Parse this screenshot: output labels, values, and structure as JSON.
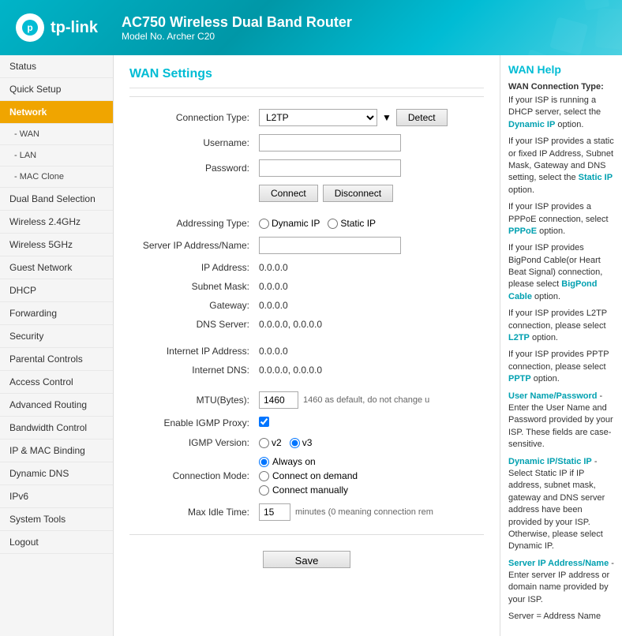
{
  "header": {
    "logo_letter": "p",
    "logo_brand": "tp-link",
    "title": "AC750 Wireless Dual Band Router",
    "model": "Model No. Archer C20"
  },
  "sidebar": {
    "items": [
      {
        "label": "Status",
        "id": "status",
        "active": false,
        "sub": false
      },
      {
        "label": "Quick Setup",
        "id": "quick-setup",
        "active": false,
        "sub": false
      },
      {
        "label": "Network",
        "id": "network",
        "active": true,
        "sub": false
      },
      {
        "label": "- WAN",
        "id": "wan",
        "active": false,
        "sub": true
      },
      {
        "label": "- LAN",
        "id": "lan",
        "active": false,
        "sub": true
      },
      {
        "label": "- MAC Clone",
        "id": "mac-clone",
        "active": false,
        "sub": true
      },
      {
        "label": "Dual Band Selection",
        "id": "dual-band",
        "active": false,
        "sub": false
      },
      {
        "label": "Wireless 2.4GHz",
        "id": "wireless-24",
        "active": false,
        "sub": false
      },
      {
        "label": "Wireless 5GHz",
        "id": "wireless-5",
        "active": false,
        "sub": false
      },
      {
        "label": "Guest Network",
        "id": "guest-network",
        "active": false,
        "sub": false
      },
      {
        "label": "DHCP",
        "id": "dhcp",
        "active": false,
        "sub": false
      },
      {
        "label": "Forwarding",
        "id": "forwarding",
        "active": false,
        "sub": false
      },
      {
        "label": "Security",
        "id": "security",
        "active": false,
        "sub": false
      },
      {
        "label": "Parental Controls",
        "id": "parental",
        "active": false,
        "sub": false
      },
      {
        "label": "Access Control",
        "id": "access-control",
        "active": false,
        "sub": false
      },
      {
        "label": "Advanced Routing",
        "id": "advanced-routing",
        "active": false,
        "sub": false
      },
      {
        "label": "Bandwidth Control",
        "id": "bandwidth",
        "active": false,
        "sub": false
      },
      {
        "label": "IP & MAC Binding",
        "id": "ip-mac",
        "active": false,
        "sub": false
      },
      {
        "label": "Dynamic DNS",
        "id": "dynamic-dns",
        "active": false,
        "sub": false
      },
      {
        "label": "IPv6",
        "id": "ipv6",
        "active": false,
        "sub": false
      },
      {
        "label": "System Tools",
        "id": "system-tools",
        "active": false,
        "sub": false
      },
      {
        "label": "Logout",
        "id": "logout",
        "active": false,
        "sub": false
      }
    ]
  },
  "content": {
    "section_title": "WAN Settings",
    "form": {
      "connection_type_label": "Connection Type:",
      "connection_type_value": "L2TP",
      "detect_btn": "Detect",
      "username_label": "Username:",
      "password_label": "Password:",
      "connect_btn": "Connect",
      "disconnect_btn": "Disconnect",
      "addressing_type_label": "Addressing Type:",
      "addressing_dynamic": "Dynamic IP",
      "addressing_static": "Static IP",
      "server_ip_label": "Server IP Address/Name:",
      "ip_address_label": "IP Address:",
      "ip_address_value": "0.0.0.0",
      "subnet_mask_label": "Subnet Mask:",
      "subnet_mask_value": "0.0.0.0",
      "gateway_label": "Gateway:",
      "gateway_value": "0.0.0.0",
      "dns_server_label": "DNS Server:",
      "dns_server_value": "0.0.0.0,  0.0.0.0",
      "internet_ip_label": "Internet IP Address:",
      "internet_ip_value": "0.0.0.0",
      "internet_dns_label": "Internet DNS:",
      "internet_dns_value": "0.0.0.0,  0.0.0.0",
      "mtu_label": "MTU(Bytes):",
      "mtu_value": "1460",
      "mtu_note": "1460 as default, do not change u",
      "igmp_proxy_label": "Enable IGMP Proxy:",
      "igmp_version_label": "IGMP Version:",
      "igmp_v2": "v2",
      "igmp_v3": "v3",
      "connection_mode_label": "Connection Mode:",
      "mode_always_on": "Always on",
      "mode_on_demand": "Connect on demand",
      "mode_manually": "Connect manually",
      "max_idle_label": "Max Idle Time:",
      "max_idle_value": "15",
      "max_idle_note": "minutes (0 meaning connection rem",
      "save_btn": "Save"
    }
  },
  "help": {
    "title": "WAN Help",
    "subtitle": "WAN Connection Type:",
    "paragraphs": [
      "If your ISP is running a DHCP server, select the Dynamic IP option.",
      "If your ISP provides a static or fixed IP Address, Subnet Mask, Gateway and DNS setting, select the Static IP option.",
      "If your ISP provides a PPPoE connection, select PPPoE option.",
      "If your ISP provides BigPond Cable(or Heart Beat Signal) connection, please select BigPond Cable option.",
      "If your ISP provides L2TP connection, please select L2TP option.",
      "If your ISP provides PPTP connection, please select PPTP option.",
      "User Name/Password - Enter the User Name and Password provided by your ISP. These fields are case-sensitive.",
      "Dynamic IP/Static IP - Select Static IP if IP address, subnet mask, gateway and DNS server address have been provided by your ISP. Otherwise, please select Dynamic IP.",
      "Server IP Address/Name - Enter server IP address or domain name provided by your ISP."
    ],
    "bold_words": [
      "Dynamic IP",
      "Static IP",
      "PPPoE",
      "BigPond Cable",
      "L2TP",
      "PPTP"
    ],
    "server_note": "Server = Address Name"
  }
}
